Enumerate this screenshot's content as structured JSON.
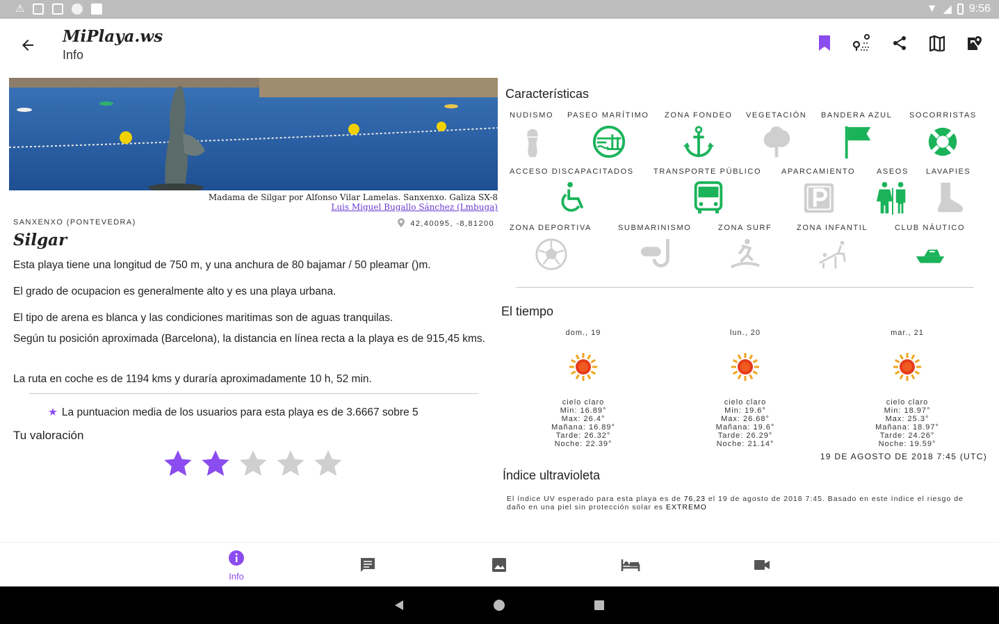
{
  "statusbar": {
    "time": "9:56"
  },
  "appbar": {
    "title": "MiPlaya.ws",
    "subtitle": "Info"
  },
  "hero": {
    "caption": "Madama de Silgar por Alfonso Vilar Lamelas. Sanxenxo. Galiza SX-8",
    "author": "Luis Miguel Bugallo Sánchez (Lmbuga)"
  },
  "beach": {
    "location": "SANXENXO (PONTEVEDRA)",
    "coords": "42,40095, -8,81200",
    "name": "Silgar",
    "p1": "Esta playa tiene una longitud de 750 m, y una anchura de 80 bajamar / 50 pleamar ()m.",
    "p2": "El grado de ocupacion es generalmente alto y es una playa urbana.",
    "p3": "El tipo de arena es blanca y las condiciones maritimas son de aguas tranquilas.",
    "p4": "Según tu posición aproximada (Barcelona), la distancia en línea recta a la playa es de 915,45 kms.",
    "p5": "La ruta en coche es de 1194 kms y duraría aproximadamente 10 h, 52 min.",
    "avg": "La puntuacion media de los usuarios para esta playa es de 3.6667 sobre 5",
    "your_rating": "Tu valoración",
    "rating": 2,
    "rating_max": 5
  },
  "features": {
    "title": "Características",
    "items": [
      {
        "label": "NUDISMO",
        "icon": "nudism-icon",
        "active": false
      },
      {
        "label": "PASEO MARÍTIMO",
        "icon": "promenade-icon",
        "active": true
      },
      {
        "label": "ZONA FONDEO",
        "icon": "anchor-icon",
        "active": true
      },
      {
        "label": "VEGETACIÓN",
        "icon": "tree-icon",
        "active": false
      },
      {
        "label": "BANDERA AZUL",
        "icon": "flag-icon",
        "active": true
      },
      {
        "label": "SOCORRISTAS",
        "icon": "lifebuoy-icon",
        "active": true
      },
      {
        "label": "ACCESO DISCAPACITADOS",
        "icon": "wheelchair-icon",
        "active": true
      },
      {
        "label": "TRANSPORTE PÚBLICO",
        "icon": "bus-icon",
        "active": true
      },
      {
        "label": "APARCAMIENTO",
        "icon": "parking-icon",
        "active": false
      },
      {
        "label": "ASEOS",
        "icon": "toilets-icon",
        "active": true
      },
      {
        "label": "LAVAPIES",
        "icon": "foot-wash-icon",
        "active": false
      },
      {
        "label": "ZONA DEPORTIVA",
        "icon": "soccer-ball-icon",
        "active": false
      },
      {
        "label": "SUBMARINISMO",
        "icon": "snorkel-icon",
        "active": false
      },
      {
        "label": "ZONA SURF",
        "icon": "surf-icon",
        "active": false
      },
      {
        "label": "ZONA INFANTIL",
        "icon": "playground-icon",
        "active": false
      },
      {
        "label": "CLUB NÁUTICO",
        "icon": "boat-icon",
        "active": true
      }
    ]
  },
  "weather": {
    "title": "El tiempo",
    "days": [
      {
        "day": "dom., 19",
        "desc": "cielo claro",
        "min": "Min: 16.89°",
        "max": "Max: 26.4°",
        "morning": "Mañana: 16.89°",
        "afternoon": "Tarde: 26.32°",
        "night": "Noche: 22.39°"
      },
      {
        "day": "lun., 20",
        "desc": "cielo claro",
        "min": "Min: 19.6°",
        "max": "Max: 26.68°",
        "morning": "Mañana: 19.6°",
        "afternoon": "Tarde: 26.29°",
        "night": "Noche: 21.14°"
      },
      {
        "day": "mar., 21",
        "desc": "cielo claro",
        "min": "Min: 18.97°",
        "max": "Max: 25.3°",
        "morning": "Mañana: 18.97°",
        "afternoon": "Tarde: 24.26°",
        "night": "Noche: 19.59°"
      }
    ],
    "updated": "19 DE AGOSTO DE 2018 7:45 (UTC)"
  },
  "uv": {
    "title": "Índice ultravioleta",
    "text_before": "El índice UV esperado para esta playa es de ",
    "value": "76,23",
    "text_middle": " el 19 de agosto de 2018 7:45. Basado en este índice el riesgo de daño en una piel sin protección solar es ",
    "level": "EXTREMO"
  },
  "nav": {
    "info_label": "Info"
  },
  "colors": {
    "accent": "#8b4cf0",
    "green": "#1bb35a",
    "inactive": "#cfcfcf"
  }
}
